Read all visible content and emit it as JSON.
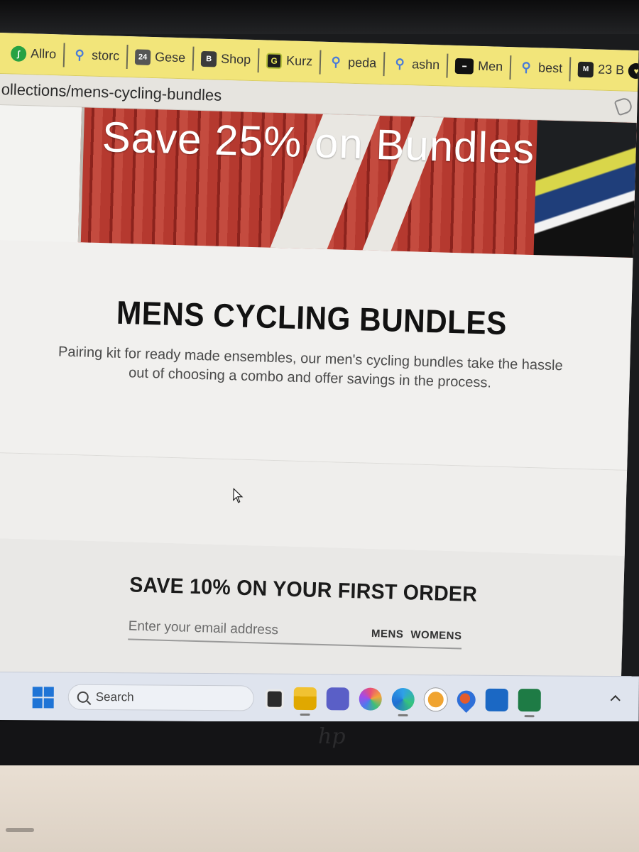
{
  "browser": {
    "bookmarks": [
      {
        "label": "Allro",
        "icon": "allrounder-icon"
      },
      {
        "label": "storc",
        "icon": "search-icon"
      },
      {
        "label": "Gese",
        "icon": "24-icon"
      },
      {
        "label": "Shop",
        "icon": "shop-icon"
      },
      {
        "label": "Kurz",
        "icon": "kurz-icon"
      },
      {
        "label": "peda",
        "icon": "search-icon"
      },
      {
        "label": "ashn",
        "icon": "search-icon"
      },
      {
        "label": "Men",
        "icon": "alfine-icon"
      },
      {
        "label": "best",
        "icon": "search-icon"
      },
      {
        "label": "23 B",
        "icon": "m-icon"
      }
    ],
    "address": "ollections/mens-cycling-bundles"
  },
  "hero": {
    "title": "Save 25% on Bundles"
  },
  "collection": {
    "title": "MENS CYCLING BUNDLES",
    "description": "Pairing kit for ready made ensembles, our men's cycling bundles take the hassle out of choosing a combo and offer savings in the process."
  },
  "newsletter": {
    "heading": "SAVE 10% ON YOUR FIRST ORDER",
    "email_placeholder": "Enter your email address",
    "mens_label": "MENS",
    "womens_label": "WOMENS"
  },
  "taskbar": {
    "search_label": "Search",
    "apps": [
      "file-explorer-icon",
      "folder-icon",
      "teams-icon",
      "copilot-icon",
      "edge-icon",
      "keeper-icon",
      "maps-icon",
      "outlook-icon",
      "excel-icon"
    ]
  },
  "colors": {
    "bookmark_bar": "#f2e57a",
    "hero_red": "#b5392f",
    "page_bg": "#f1f0ee",
    "taskbar_bg": "#dfe4ee"
  }
}
